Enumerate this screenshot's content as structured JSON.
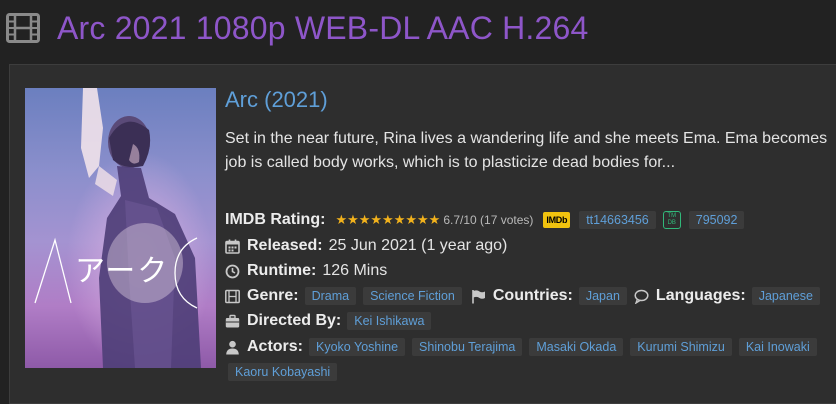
{
  "page": {
    "title": "Arc 2021 1080p WEB-DL AAC H.264"
  },
  "movie": {
    "title": "Arc (2021)",
    "overview_line1": "Set in the near future, Rina lives a wandering life and she meets Ema. Ema becomes",
    "overview_line2": "job is called body works, which is to plasticize dead bodies for...",
    "poster_logo_text": "アーク"
  },
  "details": {
    "imdb_label": "IMDB Rating:",
    "stars": "★★★★★★★★★",
    "rating_text": "6.7/10 (17 votes)",
    "imdb_badge": "IMDb",
    "imdb_id": "tt14663456",
    "tmdb_badge_line1": "TM",
    "tmdb_badge_line2": "DB",
    "tmdb_id": "795092",
    "released_label": "Released:",
    "released_value": "25 Jun 2021 (1 year ago)",
    "runtime_label": "Runtime:",
    "runtime_value": "126 Mins",
    "genre_label": "Genre:",
    "genres": [
      "Drama",
      "Science Fiction"
    ],
    "countries_label": "Countries:",
    "countries": [
      "Japan"
    ],
    "languages_label": "Languages:",
    "languages": [
      "Japanese"
    ],
    "director_label": "Directed By:",
    "directors": [
      "Kei Ishikawa"
    ],
    "actors_label": "Actors:",
    "actors": [
      "Kyoko Yoshine",
      "Shinobu Terajima",
      "Masaki Okada",
      "Kurumi Shimizu",
      "Kai Inowaki",
      "Kaoru Kobayashi"
    ]
  },
  "colors": {
    "title_purple": "#8e56c9",
    "link_blue": "#5f9fd8",
    "star_gold": "#f2b21c",
    "imdb_yellow": "#f1c30f",
    "tmdb_green": "#31b87a",
    "background": "#222222",
    "panel": "#2e2e2e"
  },
  "icons": {
    "header": "film-icon",
    "released": "calendar-icon",
    "runtime": "clock-icon",
    "genre": "film-icon",
    "countries": "flag-icon",
    "languages": "speech-bubble-icon",
    "director": "briefcase-icon",
    "actors": "user-icon"
  }
}
